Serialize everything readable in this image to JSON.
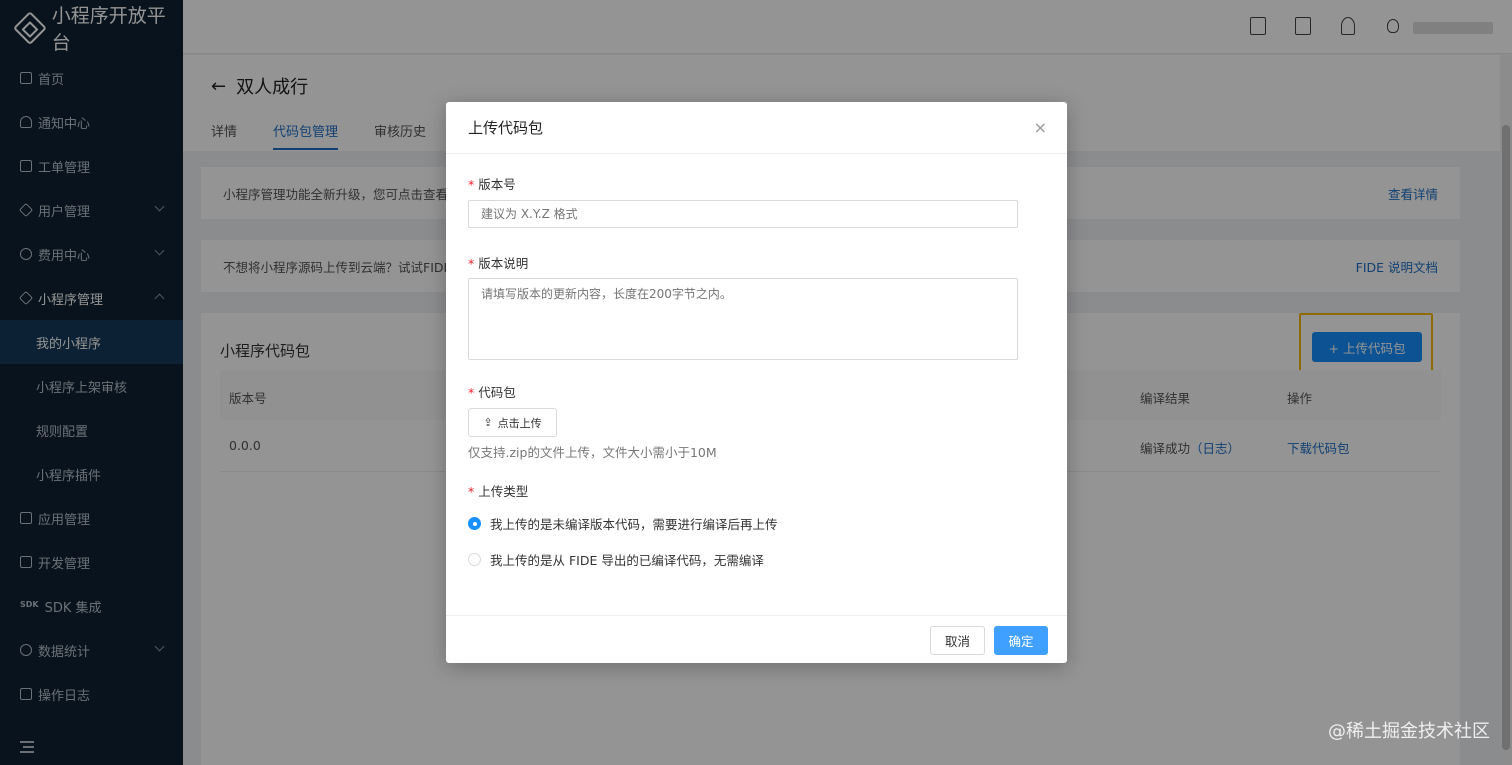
{
  "app": {
    "title": "小程序开放平台"
  },
  "sidebar": {
    "items": [
      {
        "label": "首页"
      },
      {
        "label": "通知中心"
      },
      {
        "label": "工单管理"
      },
      {
        "label": "用户管理"
      },
      {
        "label": "费用中心"
      },
      {
        "label": "小程序管理"
      },
      {
        "label": "我的小程序"
      },
      {
        "label": "小程序上架审核"
      },
      {
        "label": "规则配置"
      },
      {
        "label": "小程序插件"
      },
      {
        "label": "应用管理"
      },
      {
        "label": "开发管理"
      },
      {
        "label": "SDK 集成"
      },
      {
        "label": "数据统计"
      },
      {
        "label": "操作日志"
      }
    ]
  },
  "page": {
    "title": "双人成行",
    "tabs": [
      {
        "label": "详情"
      },
      {
        "label": "代码包管理"
      },
      {
        "label": "审核历史"
      }
    ],
    "notice1": {
      "text": "小程序管理功能全新升级，您可点击查看",
      "link": "查看详情"
    },
    "notice2": {
      "text": "不想将小程序源码上传到云端？试试FIDE",
      "link": "FIDE 说明文档"
    },
    "panel": {
      "title": "小程序代码包",
      "upload_button": "+ 上传代码包",
      "columns": {
        "version": "版本号",
        "compile_result": "编译结果",
        "actions": "操作"
      },
      "rows": [
        {
          "version": "0.0.0",
          "compile_result": "编译成功",
          "log_link": "（日志）",
          "action": "下载代码包"
        }
      ]
    }
  },
  "modal": {
    "title": "上传代码包",
    "close": "×",
    "version_label": "版本号",
    "version_placeholder": "建议为 X.Y.Z 格式",
    "desc_label": "版本说明",
    "desc_placeholder": "请填写版本的更新内容，长度在200字节之内。",
    "package_label": "代码包",
    "upload_file_button": "点击上传",
    "package_hint": "仅支持.zip的文件上传，文件大小需小于10M",
    "type_label": "上传类型",
    "type_options": [
      {
        "label": "我上传的是未编译版本代码，需要进行编译后再上传",
        "checked": true
      },
      {
        "label": "我上传的是从 FIDE 导出的已编译代码，无需编译",
        "checked": false
      }
    ],
    "cancel": "取消",
    "confirm": "确定"
  },
  "watermark": "@稀土掘金技术社区",
  "colors": {
    "primary": "#1890ff",
    "sidebar_bg": "#0e2233",
    "highlight": "#f5b800",
    "required": "#f5222d"
  }
}
